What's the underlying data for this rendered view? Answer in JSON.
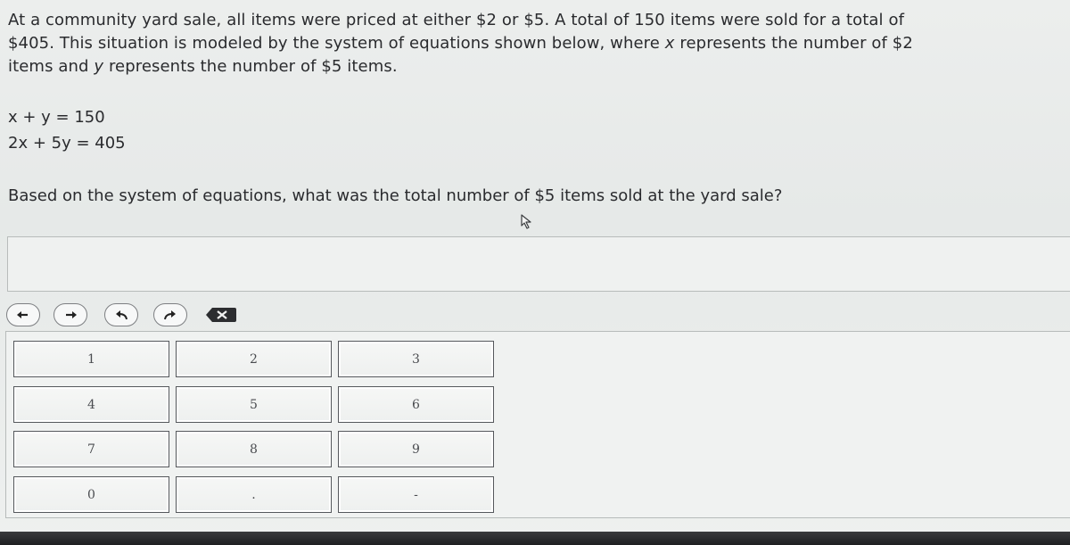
{
  "question": {
    "line1": "At a community yard sale, all items were priced at either $2 or $5. A total of 150 items were sold for a total of",
    "line2_a": "$405. This situation is modeled by the system of equations shown below, where ",
    "line2_var": "x",
    "line2_b": " represents the number of $2",
    "line3_a": "items and ",
    "line3_var": "y",
    "line3_b": " represents the number of $5 items."
  },
  "equations": [
    "x + y = 150",
    "2x + 5y = 405"
  ],
  "prompt": "Based on the system of equations, what was the total number of $5 items sold at the yard sale?",
  "answer": {
    "value": ""
  },
  "toolbar": {
    "buttons": [
      {
        "icon": "arrow-left-icon"
      },
      {
        "icon": "arrow-right-icon"
      },
      {
        "icon": "undo-icon"
      },
      {
        "icon": "redo-icon"
      },
      {
        "icon": "backspace-icon"
      }
    ]
  },
  "keypad": {
    "keys": [
      "1",
      "2",
      "3",
      "4",
      "5",
      "6",
      "7",
      "8",
      "9",
      "0",
      ".",
      "-"
    ]
  }
}
